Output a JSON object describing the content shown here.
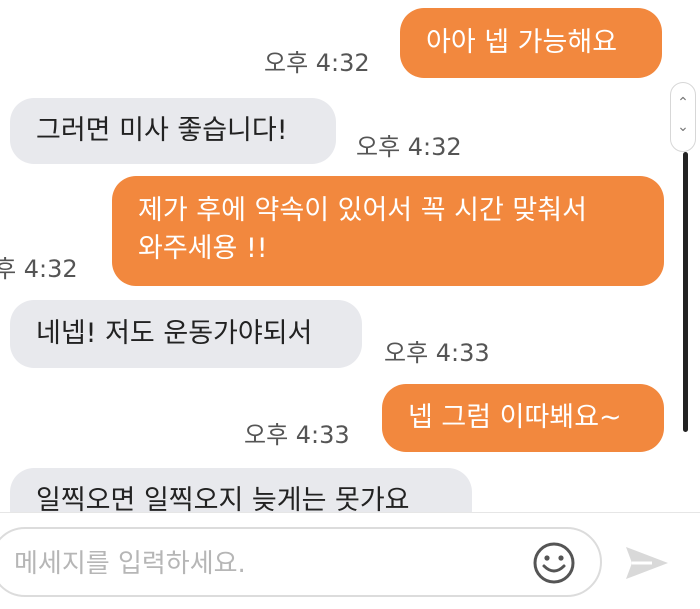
{
  "messages": [
    {
      "side": "out",
      "text": "아아 넵 가능해요",
      "time": "오후 4:32"
    },
    {
      "side": "in",
      "text": "그러면 미사 좋습니다!",
      "time": "오후 4:32"
    },
    {
      "side": "out",
      "lines": [
        "제가 후에 약속이 있어서 꼭 시간 맞춰서",
        "와주세용 !!"
      ],
      "time": "오후 4:32"
    },
    {
      "side": "in",
      "text": "네넵! 저도 운동가야되서",
      "time": "오후 4:33"
    },
    {
      "side": "out",
      "text": "넵 그럼 이따봬요~",
      "time": "오후 4:33"
    },
    {
      "side": "in",
      "text": "일찍오면 일찍오지 늦게는 못가요",
      "time": ""
    }
  ],
  "composer": {
    "placeholder": "메세지를 입력하세요.",
    "emoji_icon": "smiley-icon",
    "send_icon": "send-arrow-icon"
  },
  "colors": {
    "outgoing_bubble": "#f2883e",
    "incoming_bubble": "#e8e9ed",
    "background": "#ffffff"
  }
}
